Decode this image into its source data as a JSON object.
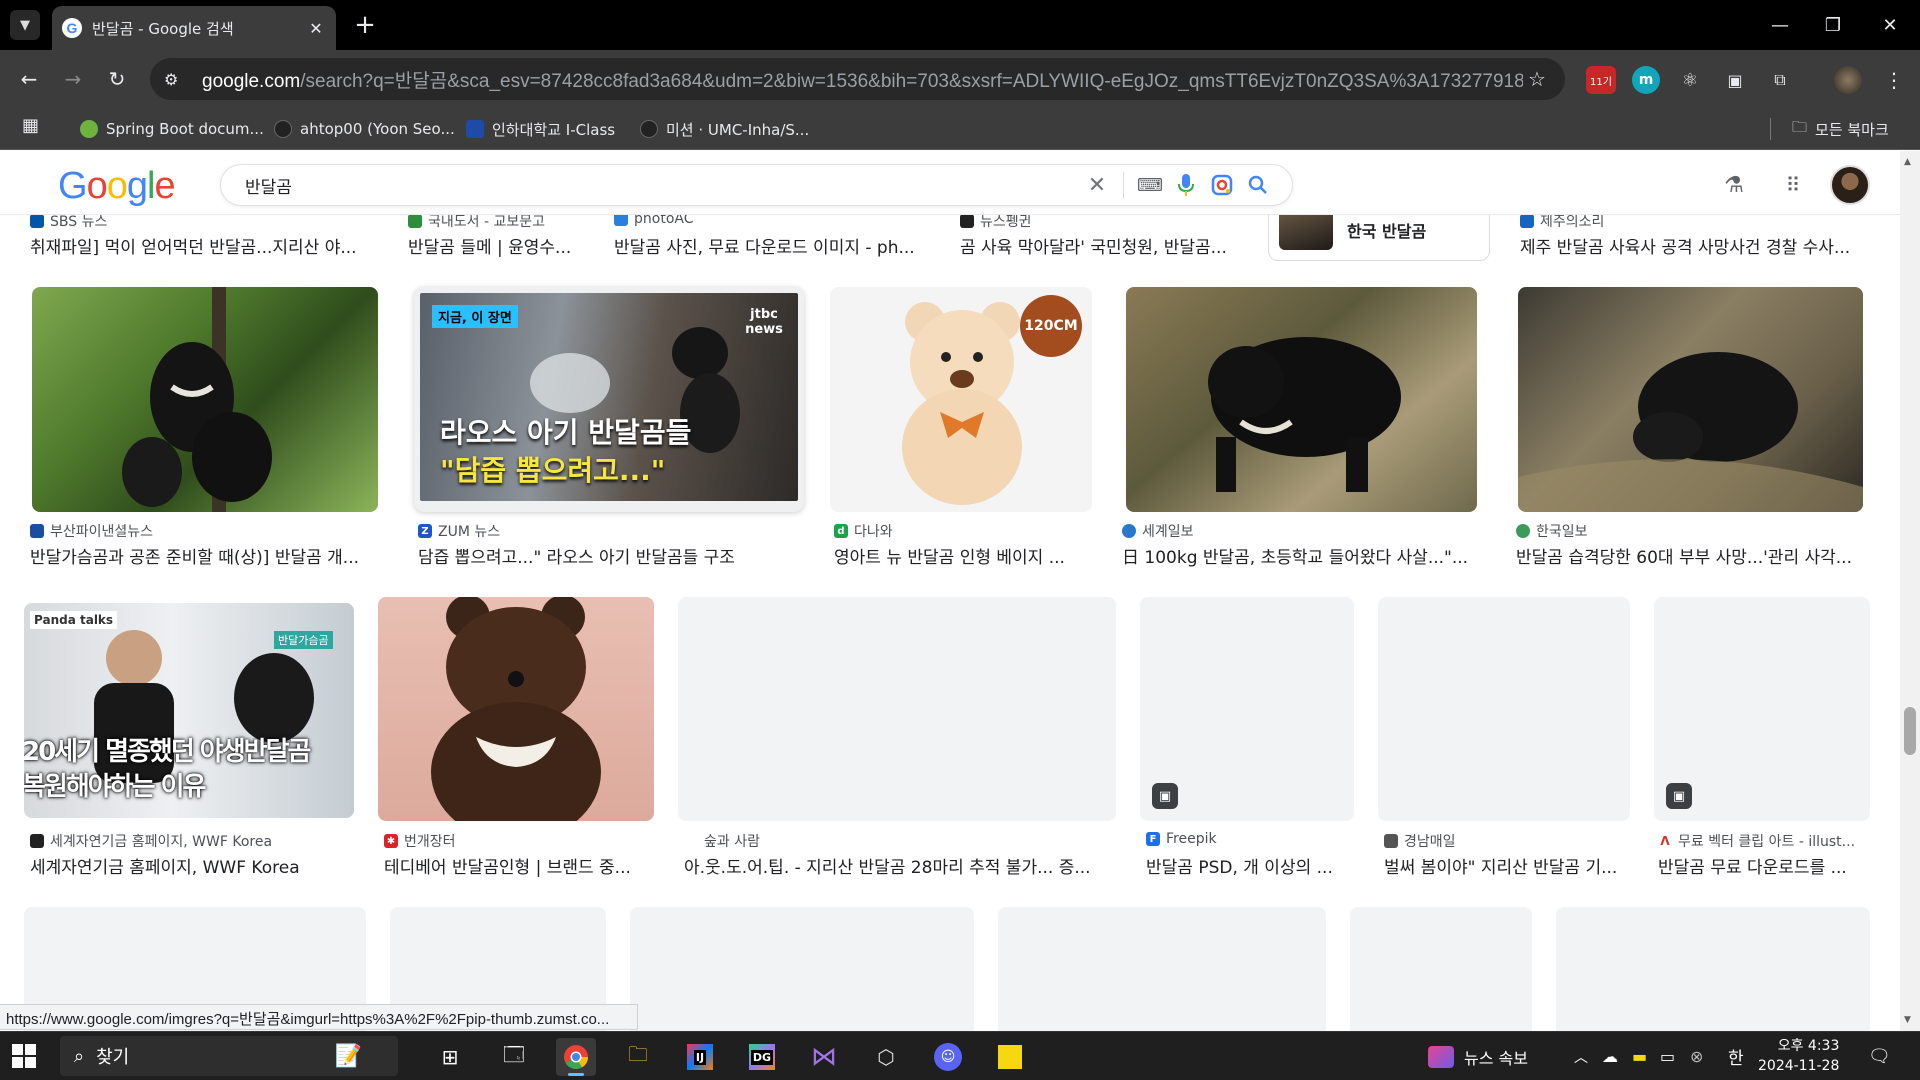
{
  "browser": {
    "tab_title": "반달곰 - Google 검색",
    "tab_list_icon": "chevron-down-icon",
    "url_host": "google.com",
    "url_rest": "/search?q=반달곰&sca_esv=87428cc8fad3a684&udm=2&biw=1536&bih=703&sxsrf=ADLYWIIQ-eEgJOz_qmsTT6EvjzT0nZQ3SA%3A1732779189221&ei...",
    "ext_badge": "11기",
    "ext_m": "m",
    "bookmarks": [
      {
        "label": "Spring Boot docum...",
        "color": "#6db33f"
      },
      {
        "label": "ahtop00 (Yoon Seo...",
        "color": "#222222"
      },
      {
        "label": "인하대학교 I-Class",
        "color": "#1e4aa8"
      },
      {
        "label": "미션 · UMC-Inha/S...",
        "color": "#222222"
      }
    ],
    "all_bookmarks": "모든 북마크",
    "status_url": "https://www.google.com/imgres?q=반달곰&imgurl=https%3A%2F%2Fpip-thumb.zumst.co..."
  },
  "google": {
    "logo_letters": [
      "G",
      "o",
      "o",
      "g",
      "l",
      "e"
    ],
    "query": "반달곰"
  },
  "top_row": [
    {
      "source": "SBS 뉴스",
      "title": "취재파일] 먹이 얻어먹던 반달곰...지리산 야...",
      "color": "#0057a8"
    },
    {
      "source": "국내도서 - 교보문고",
      "title": "반달곰 들메 | 윤영수...",
      "color": "#2d8f3c"
    },
    {
      "source": "photoAC",
      "title": "반달곰 사진, 무료 다운로드 이미지 - ph...",
      "color": "#2a7de1"
    },
    {
      "source": "뉴스펭귄",
      "title": "곰 사육 막아달라' 국민청원, 반달곰...",
      "color": "#222222"
    },
    {
      "chip": "한국 반달곰"
    },
    {
      "source": "제주의소리",
      "title": "제주 반달곰 사육사 공격 사망사건 경찰 수사...",
      "color": "#1565c0"
    }
  ],
  "row2": [
    {
      "source": "부산파이낸셜뉴스",
      "title": "반달가슴곰과 공존 준비할 때(상)] 반달곰 개...",
      "color": "#1a4fa0"
    },
    {
      "source": "ZUM 뉴스",
      "title": "담즙 뽑으려고...\" 라오스 아기 반달곰들 구조",
      "color": "#2255cc",
      "overlay_tag": "지금, 이 장면",
      "overlay_line1": "라오스 아기 반달곰들",
      "overlay_line2": "\"담즙 뽑으려고...\"",
      "overlay_logo": "jtbc news"
    },
    {
      "source": "다나와",
      "title": "영아트 뉴 반달곰 인형 베이지 ...",
      "color": "#1aa34a",
      "badge": "120CM"
    },
    {
      "source": "세계일보",
      "title": "日 100kg 반달곰, 초등학교 들어왔다 사살...\"...",
      "color": "#2b77c9"
    },
    {
      "source": "한국일보",
      "title": "반달곰 습격당한 60대 부부 사망...'관리 사각...",
      "color": "#3c9a5a"
    }
  ],
  "row3": [
    {
      "source": "세계자연기금 홈페이지, WWF Korea",
      "title": "세계자연기금 홈페이지, WWF Korea",
      "color": "#222222",
      "overlay_tag": "Panda talks",
      "overlay_sign": "반달가슴곰",
      "overlay_line1": "20세기 멸종했던 야생반달곰",
      "overlay_line2": "복원해야하는 이유"
    },
    {
      "source": "번개장터",
      "title": "테디베어 반달곰인형 | 브랜드 중...",
      "color": "#d9252a"
    },
    {
      "source": "숲과 사람",
      "title": "아.웃.도.어.팁. - 지리산 반달곰 28마리 추적 불가... 증...",
      "color": "#ffffff"
    },
    {
      "source": "Freepik",
      "title": "반달곰 PSD, 개 이상의 ...",
      "color": "#1f6fe5"
    },
    {
      "source": "경남매일",
      "title": "벌써 봄이야\" 지리산 반달곰 기...",
      "color": "#555555"
    },
    {
      "source": "무료 벡터 클립 아트 - illust...",
      "title": "반달곰 무료 다운로드를 ...",
      "color": "#d93025"
    }
  ],
  "taskbar": {
    "search_label": "찾기",
    "news_label": "뉴스 속보",
    "ime": "한",
    "time": "오후 4:33",
    "date": "2024-11-28"
  }
}
